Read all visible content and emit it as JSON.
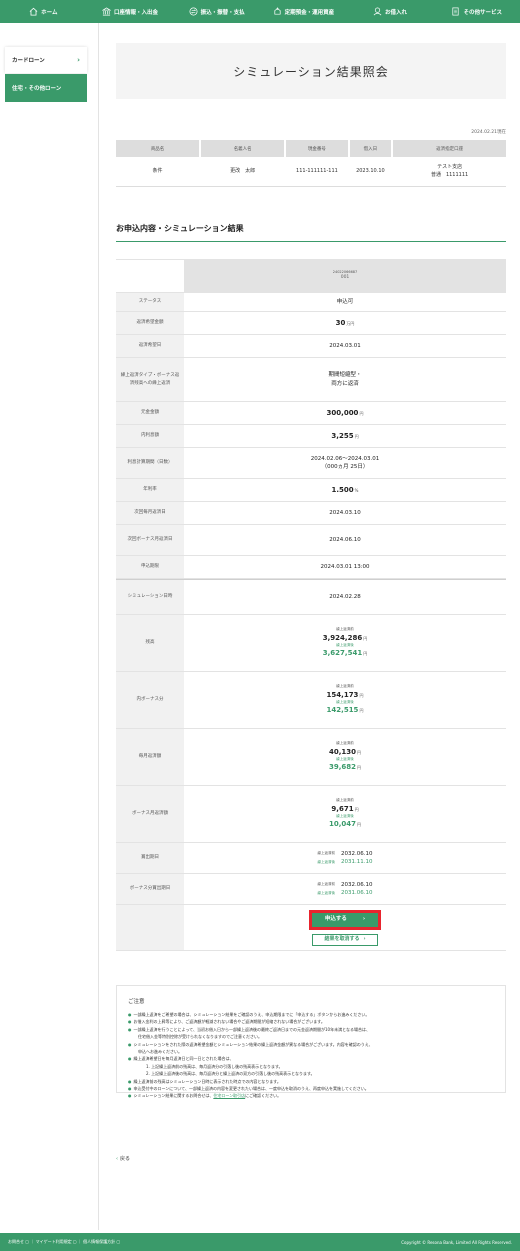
{
  "nav": [
    {
      "label": "ホーム",
      "icon": "home-icon"
    },
    {
      "label": "口座情報・入出金",
      "icon": "bank-icon"
    },
    {
      "label": "振込・振替・支払",
      "icon": "transfer-icon"
    },
    {
      "label": "定期預金・運用資産",
      "icon": "savings-icon"
    },
    {
      "label": "お借入れ",
      "icon": "loan-icon"
    },
    {
      "label": "その他サービス",
      "icon": "document-icon"
    }
  ],
  "sidebar": {
    "card_loan": "カードローン",
    "housing_loan": "住宅・その他ローン",
    "chevron": "›"
  },
  "page_title": "シミュレーション結果照会",
  "as_of": "2024.02.21現在",
  "info_table": {
    "headers": [
      "商品名",
      "名義人名",
      "現金番号",
      "借入日",
      "返済指定口座"
    ],
    "row": {
      "product": "条件",
      "holder": "更改　太郎",
      "number": "111-111111-111",
      "date": "2023.10.10",
      "account_branch": "テスト支店",
      "account_no": "普通　1111111"
    }
  },
  "section_title": "お申込内容・シミュレーション結果",
  "sim": {
    "head_id": "24022066687",
    "head_sub": "001",
    "status": {
      "label": "ステータス",
      "value": "申込可"
    },
    "desired_amount": {
      "label": "返済希望金額",
      "value": "30",
      "unit": "万円"
    },
    "desired_date": {
      "label": "返済希望日",
      "value": "2024.03.01"
    },
    "repay_type": {
      "label": "繰上返済タイプ・ボーナス返済残高への繰上返済",
      "value1": "期間短縮型・",
      "value2": "両方に返済"
    },
    "principal": {
      "label": "元金金額",
      "value": "300,000",
      "unit": "円"
    },
    "interest": {
      "label": "内利息額",
      "value": "3,255",
      "unit": "円"
    },
    "period": {
      "label": "利息計算期間（日数）",
      "value1": "2024.02.06～2024.03.01",
      "value2": "（000ヵ月 25日）"
    },
    "rate": {
      "label": "年利率",
      "value": "1.500",
      "unit": "%"
    },
    "next_monthly": {
      "label": "次回毎月返済日",
      "value": "2024.03.10"
    },
    "next_bonus": {
      "label": "次回ボーナス月返済日",
      "value": "2024.06.10"
    },
    "deadline": {
      "label": "申込期限",
      "value": "2024.03.01 13:00"
    },
    "sim_datetime": {
      "label": "シミュレーション日時",
      "value": "2024.02.28"
    },
    "before_tag": "繰上返済前",
    "after_tag": "繰上返済後",
    "balance": {
      "label": "残高",
      "before": "3,924,286",
      "after": "3,627,541",
      "unit": "円"
    },
    "bonus_part": {
      "label": "内ボーナス分",
      "before": "154,173",
      "after": "142,515",
      "unit": "円"
    },
    "monthly": {
      "label": "毎月返済額",
      "before": "40,130",
      "after": "39,682",
      "unit": "円"
    },
    "bonus_monthly": {
      "label": "ボーナス月返済額",
      "before": "9,671",
      "after": "10,047",
      "unit": "円"
    },
    "final_date": {
      "label": "賞出期日",
      "before": "2032.06.10",
      "after": "2031.11.10"
    },
    "bonus_final": {
      "label": "ボーナス分賞出期日",
      "before": "2032.06.10",
      "after": "2031.06.10"
    }
  },
  "buttons": {
    "apply": "申込する",
    "cancel": "結果を取消する",
    "arrow": "›"
  },
  "notes": {
    "title": "ご注意",
    "bullet": "●",
    "lines": [
      "一部繰上返済をご希望の場合は、シミュレーション結果をご確認のうえ、申込期限までに「申込する」ボタンからお進みください。",
      "お借入金利の上昇等により、ご返済額が軽減されない場合やご返済期間が短縮されない場合がございます。",
      "一部繰上返済を行うことによって、当初お借入日から一部繰上返済後の最終ご返済日までの元金返済期間が10年未満となる場合は、",
      "住宅借入金等特別控除が受けられなくなりますのでご注意ください。",
      "シミュレーションをされた際の返済希望金額とシミュレーション結果の繰上返済金額が異なる場合がございます。内容を確認のうえ、",
      "申込へお進みください。",
      "繰上返済希望日を毎月返済日と同一日とされた場合は、",
      "1. 上記繰上返済前の残高は、毎月返済分の引落し後の残高表示となります。",
      "2. 上記繰上返済後の残高は、毎月返済分と繰上返済の双方の引落し後の残高表示となります。",
      "繰上返済前の残高はシミュレーション日時に表示された時点での内容となります。",
      "申込受付中のローンについて、一部繰上返済の内容を変更されたい場合は、一度申込を取消のうえ、再度申込を実施してください。",
      "シミュレーション結果に関するお問合せは、",
      "住宅ローン取引店",
      "にご確認ください。"
    ]
  },
  "back": {
    "label": "戻る",
    "chevron": "‹"
  },
  "footer": {
    "links": "お問合せ ▢ ｜ マイゲート利用規定 ▢ ｜ 個人情報保護方針 ▢",
    "copyright": "Copyright © Resona Bank, Limited All Rights Reserved."
  }
}
